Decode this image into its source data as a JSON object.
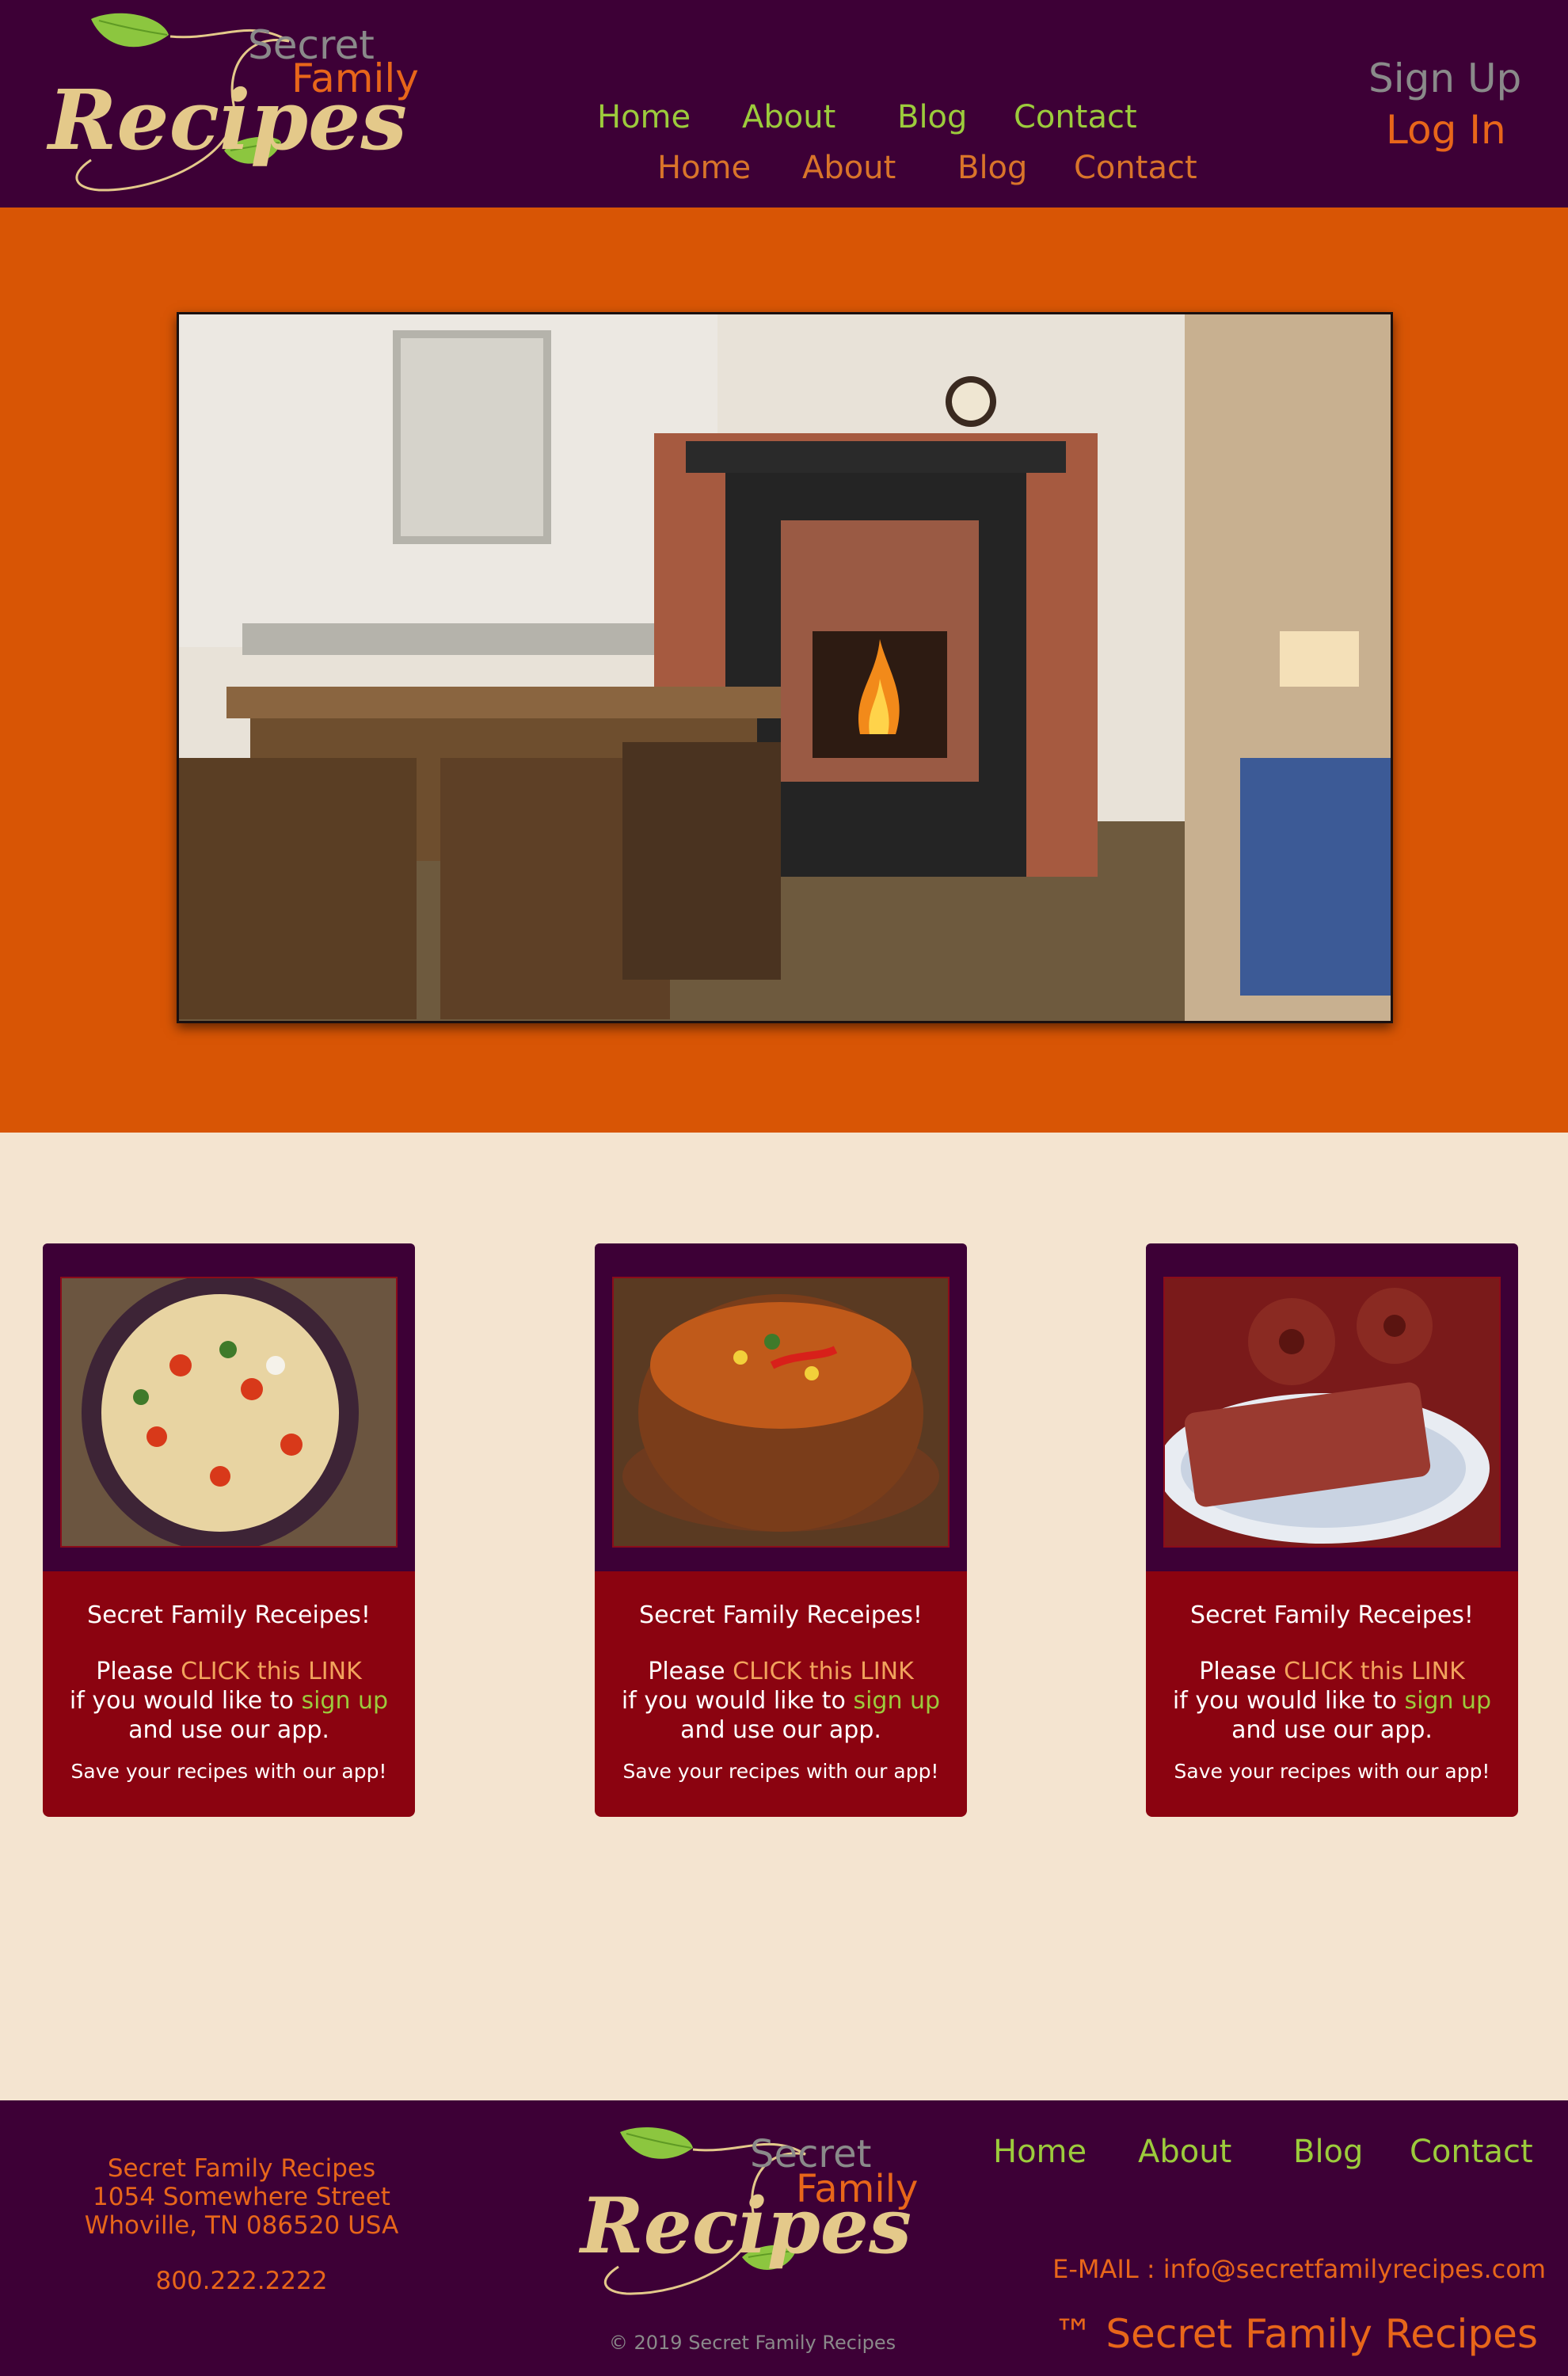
{
  "header": {
    "logo": {
      "secret": "Secret",
      "family": "Family",
      "recipes": "Recipes"
    },
    "nav_primary": [
      "Home",
      "About",
      "Blog",
      "Contact"
    ],
    "nav_secondary": [
      "Home",
      "About",
      "Blog",
      "Contact"
    ],
    "signup": "Sign Up",
    "login": "Log In"
  },
  "cards": [
    {
      "title": "Secret Family Receipes!",
      "please": "Please",
      "link": "CLICK this LINK",
      "line2a": "if you would like to",
      "signup": "sign up",
      "line3": "and use our app.",
      "save": "Save your recipes with our app!",
      "image": "bowtie-pasta-with-tomatoes"
    },
    {
      "title": "Secret Family Receipes!",
      "please": "Please",
      "link": "CLICK this LINK",
      "line2a": "if you would like to",
      "signup": "sign up",
      "line3": "and use our app.",
      "save": "Save your recipes with our app!",
      "image": "bean-and-vegetable-soup"
    },
    {
      "title": "Secret Family Receipes!",
      "please": "Please",
      "link": "CLICK this LINK",
      "line2a": "if you would like to",
      "signup": "sign up",
      "line3": "and use our app.",
      "save": "Save your recipes with our app!",
      "image": "red-velvet-waffles-and-bundt-cakes"
    }
  ],
  "footer": {
    "address": [
      "Secret Family Recipes",
      "1054 Somewhere Street",
      "Whoville, TN 086520 USA"
    ],
    "phone": "800.222.2222",
    "logo": {
      "secret": "Secret",
      "family": "Family",
      "recipes": "Recipes"
    },
    "copyright": "© 2019 Secret Family Recipes",
    "nav": [
      "Home",
      "About",
      "Blog",
      "Contact"
    ],
    "email": "E-MAIL : info@secretfamilyrecipes.com",
    "trademark": "™ Secret Family Recipes"
  },
  "colors": {
    "header_bg": "#3d0036",
    "hero_bg": "#d85505",
    "page_bg": "#f4e4d0",
    "card_red": "#8b0310",
    "nav_green": "#9ccb3c",
    "accent_orange": "#e8661a"
  }
}
